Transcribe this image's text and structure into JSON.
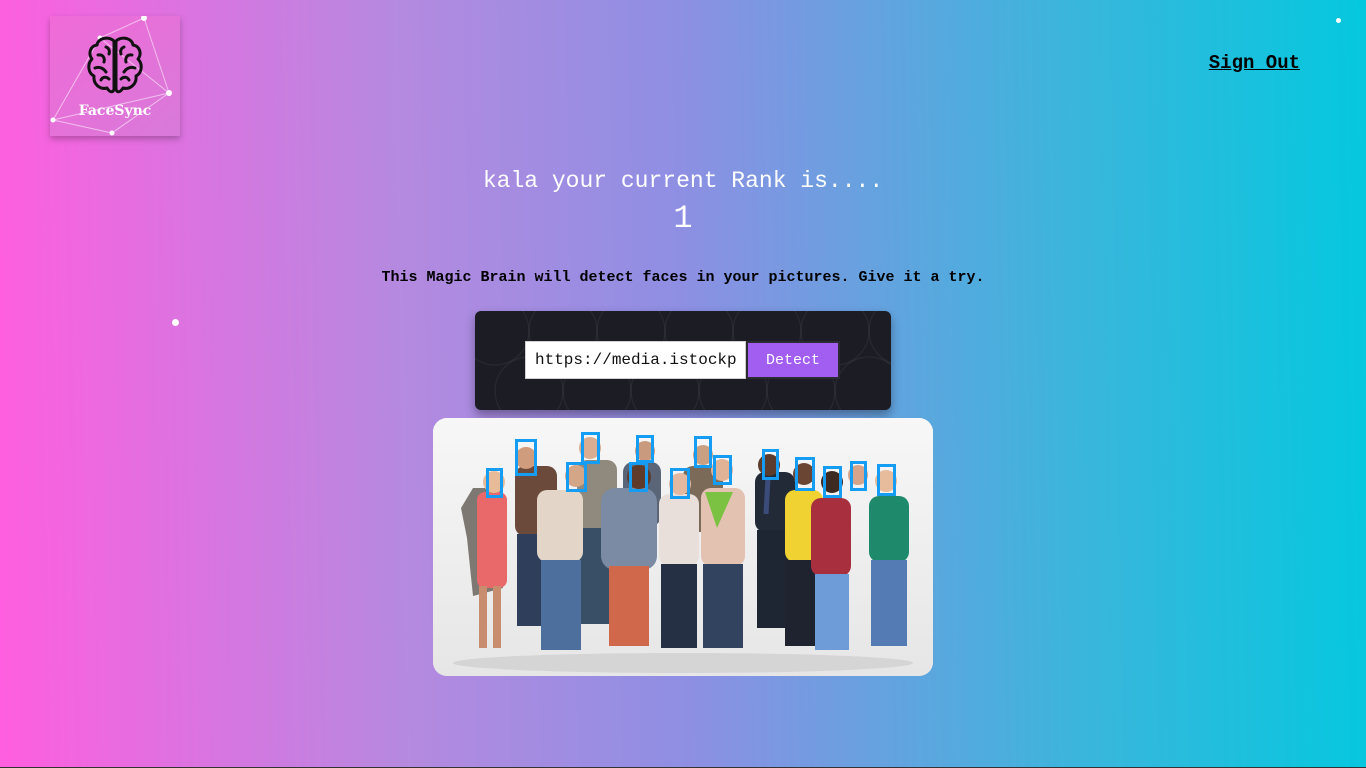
{
  "logo": {
    "brand_name": "FaceSync",
    "icon": "brain-icon"
  },
  "nav": {
    "signout_label": "Sign Out"
  },
  "rank": {
    "message": "kala your current Rank is....",
    "value": "1"
  },
  "tagline": "This Magic Brain will detect faces in your pictures. Give it a try.",
  "form": {
    "url_value": "https://media.istockphoto.com",
    "detect_label": "Detect"
  },
  "image": {
    "face_count": 15
  },
  "colors": {
    "gradient_start": "#ff5edf",
    "gradient_end": "#04c8de",
    "detect_button": "#a25ef0",
    "face_box": "#149df2",
    "panel": "#1b1c24"
  }
}
